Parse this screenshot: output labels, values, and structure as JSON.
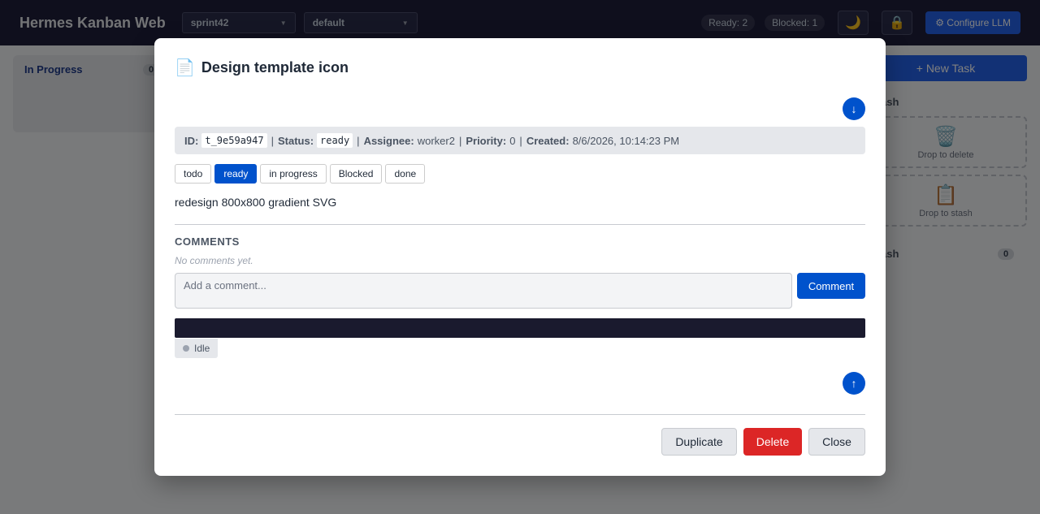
{
  "header": {
    "title": "Hermes Kanban Web",
    "board_select": "sprint42",
    "profile_select": "default",
    "ready_stat": "Ready: 2",
    "blocked_stat": "Blocked: 1",
    "theme_icon": "🌙",
    "lock_icon": "🔒",
    "configure_label": "⚙ Configure LLM"
  },
  "board": {
    "in_progress_title": "In Progress",
    "in_progress_count": "0",
    "new_task_label": "+ New Task",
    "trash_label": "ash",
    "drop_delete_icon": "🗑️",
    "drop_delete_text": "Drop to delete",
    "drop_stash_icon": "📋",
    "drop_stash_text": "Drop to stash",
    "stash_label": "ash",
    "stash_count": "0"
  },
  "modal": {
    "title_icon": "📄",
    "title": "Design template icon",
    "scroll_down_label": "↓",
    "scroll_up_label": "↑",
    "meta": {
      "id_label": "ID:",
      "id": "t_9e59a947",
      "status_label": "Status:",
      "status": "ready",
      "assignee_label": "Assignee:",
      "assignee": "worker2",
      "priority_label": "Priority:",
      "priority": "0",
      "created_label": "Created:",
      "created": "8/6/2026, 10:14:23 PM",
      "separator": "|"
    },
    "status_buttons": [
      "todo",
      "ready",
      "in progress",
      "Blocked",
      "done"
    ],
    "description": "redesign 800x800 gradient SVG",
    "comments": {
      "heading": "COMMENTS",
      "empty_text": "No comments yet.",
      "placeholder": "Add a comment...",
      "value": "",
      "submit_label": "Comment"
    },
    "agent_status": "Idle",
    "footer": {
      "duplicate_label": "Duplicate",
      "delete_label": "Delete",
      "close_label": "Close"
    }
  },
  "colors": {
    "primary": "#0052cc",
    "danger": "#dc2626",
    "header_bg": "#1e1f3b",
    "terminal_bg": "#1a1a2e"
  }
}
